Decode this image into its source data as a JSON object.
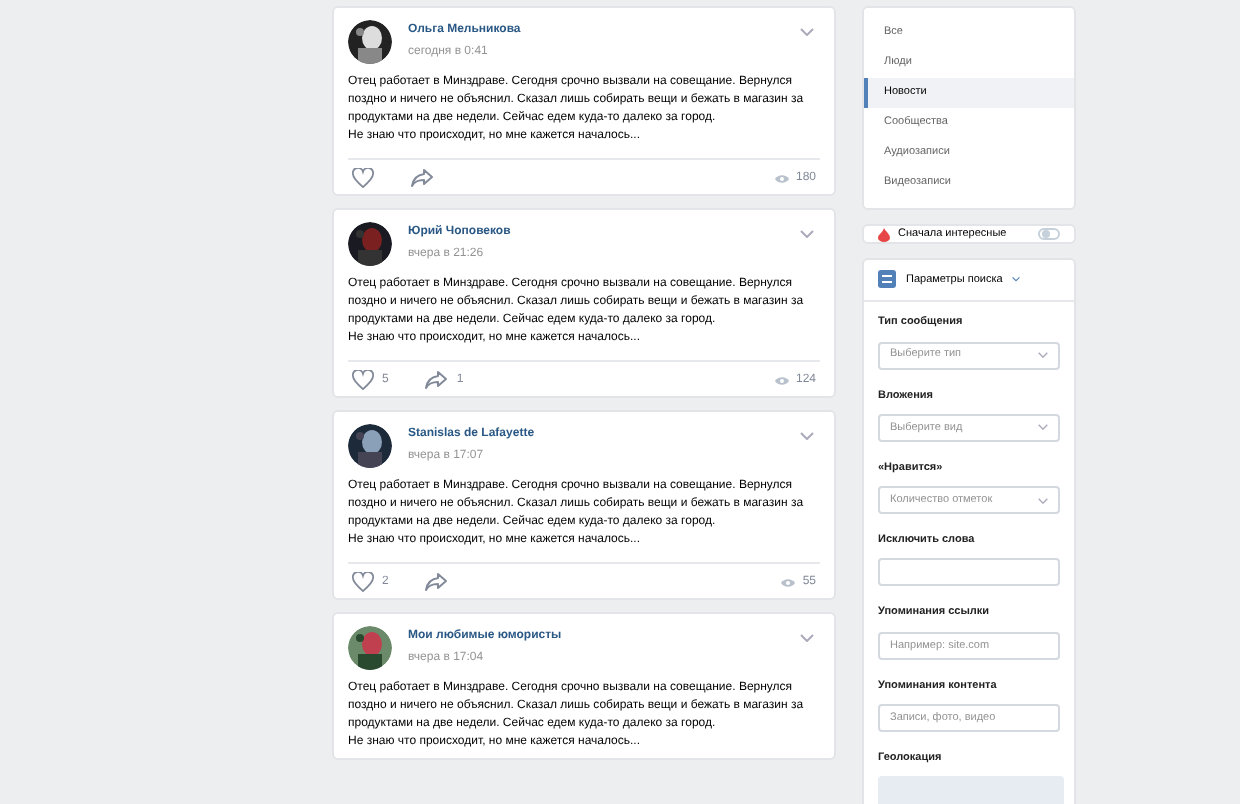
{
  "posts": [
    {
      "author": "Ольга Мельникова",
      "time": "сегодня в 0:41",
      "paragraphs": [
        "Отец работает в Минздраве. Сегодня срочно вызвали на совещание. Вернулся поздно и ничего не объяснил. Сказал лишь собирать вещи и бежать в магазин за продуктами на две недели. Сейчас едем куда-то далеко за город.",
        "Не знаю что происходит, но мне кажется началось..."
      ],
      "views": "180"
    },
    {
      "author": "Юрий Чоповеков",
      "time": "вчера в 21:26",
      "paragraphs": [
        "Отец работает в Минздраве. Сегодня срочно вызвали на совещание. Вернулся поздно и ничего не объяснил. Сказал лишь собирать вещи и бежать в магазин за продуктами на две недели. Сейчас едем куда-то далеко за город.",
        "Не знаю что происходит, но мне кажется началось..."
      ],
      "likes": "5",
      "shares": "1",
      "views": "124"
    },
    {
      "author": "Stanislas de Lafayette",
      "time": "вчера в 17:07",
      "paragraphs": [
        "Отец работает в Минздраве. Сегодня срочно вызвали на совещание. Вернулся поздно и ничего не объяснил. Сказал лишь собирать вещи и бежать в магазин за продуктами на две недели. Сейчас едем куда-то далеко за город.",
        "Не знаю что происходит, но мне кажется началось..."
      ],
      "likes": "2",
      "views": "55"
    },
    {
      "author": "Мои любимые юмористы",
      "time": "вчера в 17:04",
      "paragraphs": [
        "Отец работает в Минздраве. Сегодня срочно вызвали на совещание. Вернулся поздно и ничего не объяснил. Сказал лишь собирать вещи и бежать в магазин за продуктами на две недели. Сейчас едем куда-то далеко за город.",
        "Не знаю что происходит, но мне кажется началось..."
      ]
    }
  ],
  "menu": [
    {
      "label": "Все",
      "selected": false
    },
    {
      "label": "Люди",
      "selected": false
    },
    {
      "label": "Новости",
      "selected": true
    },
    {
      "label": "Сообщества",
      "selected": false
    },
    {
      "label": "Аудиозаписи",
      "selected": false
    },
    {
      "label": "Видеозаписи",
      "selected": false
    }
  ],
  "interesting_first": {
    "label": "Сначала интересные",
    "on": false
  },
  "search_params": {
    "title": "Параметры поиска",
    "fields": [
      {
        "kind": "select",
        "label": "Тип сообщения",
        "value": "Выберите тип"
      },
      {
        "kind": "select",
        "label": "Вложения",
        "value": "Выберите вид"
      },
      {
        "kind": "select",
        "label": "«Нравится»",
        "value": "Количество отметок"
      },
      {
        "kind": "input",
        "label": "Исключить слова"
      },
      {
        "kind": "input",
        "label": "Упоминания ссылки",
        "placeholder": "Например: site.com"
      },
      {
        "kind": "input",
        "label": "Упоминания контента",
        "placeholder": "Записи, фото, видео"
      },
      {
        "kind": "map",
        "label": "Геолокация"
      }
    ]
  }
}
